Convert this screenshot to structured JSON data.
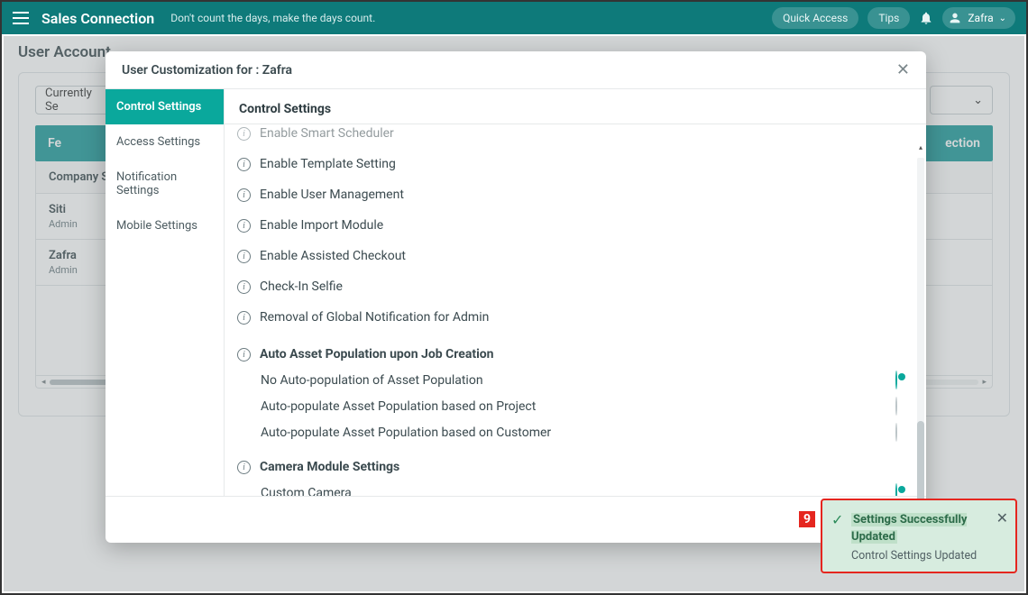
{
  "header": {
    "brand": "Sales Connection",
    "tagline": "Don't count the days, make the days count.",
    "quick_access": "Quick Access",
    "tips": "Tips",
    "user": "Zafra"
  },
  "bg": {
    "page_title": "User Account",
    "dd_label": "Currently Se",
    "head_left": "Fe",
    "head_right": "ection",
    "row0": "Company Se",
    "row1_name": "Siti",
    "row1_role": "Admin",
    "row2_name": "Zafra",
    "row2_role": "Admin"
  },
  "modal": {
    "title": "User Customization for : Zafra",
    "side": [
      "Control Settings",
      "Access Settings",
      "Notification Settings",
      "Mobile Settings"
    ],
    "section_title": "Control Settings",
    "toggles": [
      {
        "label": "Enable Smart Scheduler",
        "on": false
      },
      {
        "label": "Enable Template Setting",
        "on": true
      },
      {
        "label": "Enable User Management",
        "on": false
      },
      {
        "label": "Enable Import Module",
        "on": false
      },
      {
        "label": "Enable Assisted Checkout",
        "on": true
      },
      {
        "label": "Check-In Selfie",
        "on": false
      },
      {
        "label": "Removal of Global Notification for Admin",
        "on": true
      }
    ],
    "asset_heading": "Auto Asset Population upon Job Creation",
    "radios": [
      {
        "label": "No Auto-population of Asset Population",
        "sel": true
      },
      {
        "label": "Auto-populate Asset Population based on Project",
        "sel": false
      },
      {
        "label": "Auto-populate Asset Population based on Customer",
        "sel": false
      }
    ],
    "camera_heading": "Camera Module Settings",
    "camera_radios": [
      {
        "label": "Custom Camera",
        "sel": true
      }
    ]
  },
  "callout": {
    "num": "9"
  },
  "toast": {
    "title": "Settings Successfully Updated",
    "msg": "Control Settings Updated"
  }
}
